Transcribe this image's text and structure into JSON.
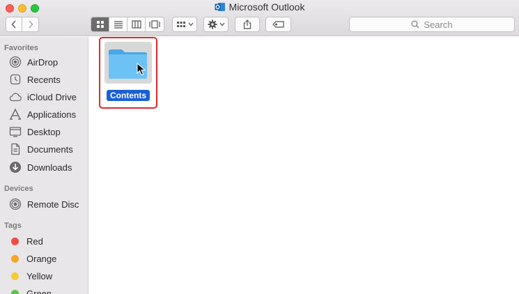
{
  "window": {
    "title": "Microsoft Outlook"
  },
  "toolbar": {
    "search_placeholder": "Search"
  },
  "sidebar": {
    "favorites_header": "Favorites",
    "favorites": [
      {
        "label": "AirDrop",
        "icon": "airdrop-icon"
      },
      {
        "label": "Recents",
        "icon": "recents-icon"
      },
      {
        "label": "iCloud Drive",
        "icon": "cloud-icon"
      },
      {
        "label": "Applications",
        "icon": "applications-icon"
      },
      {
        "label": "Desktop",
        "icon": "desktop-icon"
      },
      {
        "label": "Documents",
        "icon": "documents-icon"
      },
      {
        "label": "Downloads",
        "icon": "downloads-icon"
      }
    ],
    "devices_header": "Devices",
    "devices": [
      {
        "label": "Remote Disc",
        "icon": "disc-icon"
      }
    ],
    "tags_header": "Tags",
    "tags": [
      {
        "label": "Red",
        "color": "#ee4d47"
      },
      {
        "label": "Orange",
        "color": "#f5a623"
      },
      {
        "label": "Yellow",
        "color": "#f4cc35"
      },
      {
        "label": "Green",
        "color": "#5cc24a"
      }
    ]
  },
  "content": {
    "items": [
      {
        "label": "Contents",
        "selected": true,
        "highlight_color": "#e0262a"
      }
    ]
  },
  "colors": {
    "selection": "#1a5fd6",
    "folder": "#5bb8ef"
  }
}
